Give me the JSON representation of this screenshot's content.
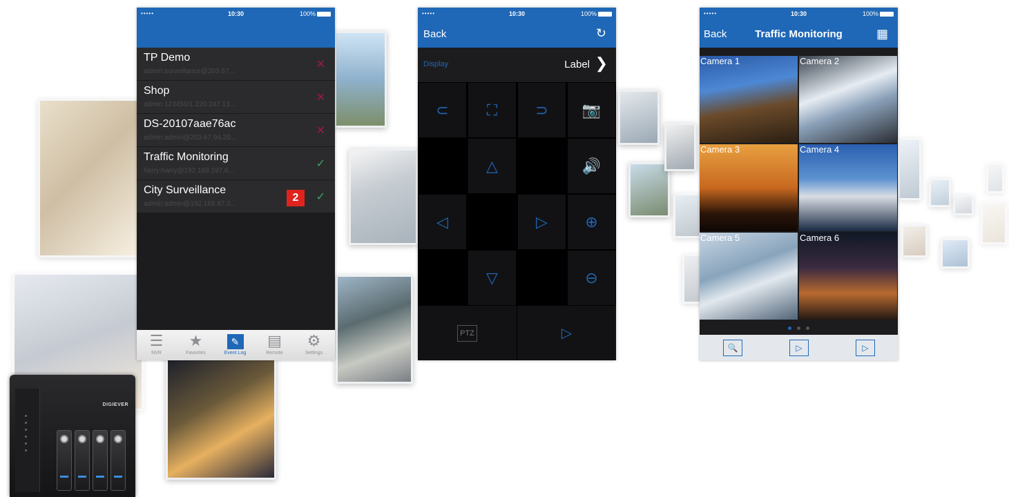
{
  "colors": {
    "brand_blue": "#1f67b7",
    "delete_red": "#a0174d",
    "ok_green": "#3aa56a",
    "badge_red": "#e0231f"
  },
  "nvr_device": {
    "brand": "DIGIEVER"
  },
  "screen1": {
    "status": {
      "signal": "•••••",
      "time": "10:30",
      "battery": "100%"
    },
    "devices": [
      {
        "name": "TP Demo",
        "sub": "admin:surveillance@203.67...",
        "status_icon": "delete-x-icon",
        "status_glyph": "✕"
      },
      {
        "name": "Shop",
        "sub": "admin:123456!1.220.247.13...",
        "status_icon": "delete-x-icon",
        "status_glyph": "✕"
      },
      {
        "name": "DS-20107aae76ac",
        "sub": "admin:admin@203.67.94.20...",
        "status_icon": "delete-x-icon",
        "status_glyph": "✕"
      },
      {
        "name": "Traffic Monitoring",
        "sub": "harry:harry@192.168.197.6...",
        "status_icon": "check-icon",
        "status_glyph": "✓"
      },
      {
        "name": "City Surveillance",
        "sub": "admin:admin@192.168.87.2...",
        "status_icon": "check-icon",
        "status_glyph": "✓",
        "badge": "2"
      }
    ],
    "tabs": [
      {
        "label": "NVR",
        "icon": "list-icon",
        "glyph": "☰"
      },
      {
        "label": "Favorites",
        "icon": "star-icon",
        "glyph": "★"
      },
      {
        "label": "Event Log",
        "icon": "event-log-icon",
        "glyph": "✎",
        "active": true
      },
      {
        "label": "Remote",
        "icon": "remote-icon",
        "glyph": "▤"
      },
      {
        "label": "Settings",
        "icon": "gear-icon",
        "glyph": "⚙"
      }
    ]
  },
  "screen2": {
    "status": {
      "signal": "•••••",
      "time": "10:30",
      "battery": "100%"
    },
    "back_label": "Back",
    "refresh_glyph": "↻",
    "display_label": "Display",
    "label_text": "Label",
    "chevron_glyph": "❯",
    "ptz_label": "PTZ",
    "playback_glyph": "▷",
    "controls": {
      "prev": "⊂",
      "fullscreen": "⛶",
      "next": "⊃",
      "snapshot": "📷",
      "up": "△",
      "audio": "🔊",
      "left": "◁",
      "right": "▷",
      "zoom_in": "⊕",
      "down": "▽",
      "zoom_out": "⊖"
    }
  },
  "screen3": {
    "status": {
      "signal": "•••••",
      "time": "10:30",
      "battery": "100%"
    },
    "back_label": "Back",
    "title": "Traffic Monitoring",
    "grid_glyph": "▦",
    "cameras": [
      {
        "label": "Camera 1"
      },
      {
        "label": "Camera 2"
      },
      {
        "label": "Camera 3"
      },
      {
        "label": "Camera 4"
      },
      {
        "label": "Camera 5"
      },
      {
        "label": "Camera 6"
      }
    ],
    "page_indicator": {
      "current": 1,
      "total": 3
    },
    "tools": [
      {
        "icon": "search-folder-icon",
        "glyph": "🔍"
      },
      {
        "icon": "play-folder-icon",
        "glyph": "▷"
      },
      {
        "icon": "playback-icon",
        "glyph": "▷"
      }
    ]
  }
}
